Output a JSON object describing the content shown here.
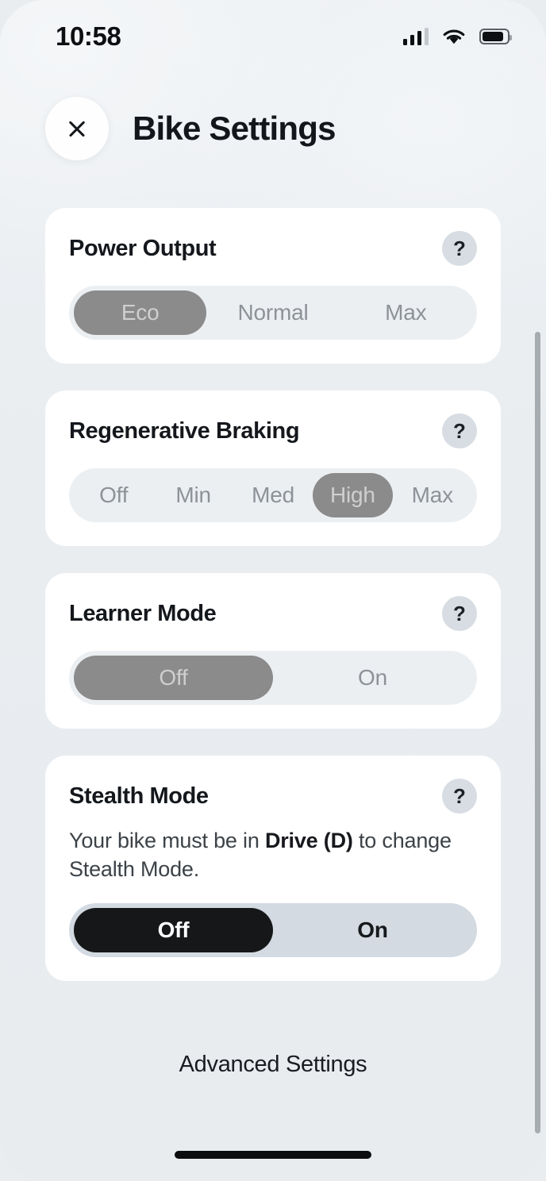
{
  "status_bar": {
    "time": "10:58",
    "cellular_icon": "cellular-signal-icon",
    "wifi_icon": "wifi-icon",
    "battery_icon": "battery-icon"
  },
  "header": {
    "close_icon": "close-icon",
    "title": "Bike Settings"
  },
  "help_label": "?",
  "cards": [
    {
      "id": "power",
      "title": "Power Output",
      "options": [
        "Eco",
        "Normal",
        "Max"
      ],
      "selected": "Eco"
    },
    {
      "id": "regen",
      "title": "Regenerative Braking",
      "options": [
        "Off",
        "Min",
        "Med",
        "High",
        "Max"
      ],
      "selected": "High"
    },
    {
      "id": "learner",
      "title": "Learner Mode",
      "options": [
        "Off",
        "On"
      ],
      "selected": "Off"
    },
    {
      "id": "stealth",
      "title": "Stealth Mode",
      "note_prefix": "Your bike must be in ",
      "note_bold": "Drive (D)",
      "note_suffix": " to change Stealth Mode.",
      "options": [
        "Off",
        "On"
      ],
      "selected": "Off"
    }
  ],
  "power": {
    "title": "Power Output",
    "opt0": "Eco",
    "opt1": "Normal",
    "opt2": "Max"
  },
  "regen": {
    "title": "Regenerative Braking",
    "opt0": "Off",
    "opt1": "Min",
    "opt2": "Med",
    "opt3": "High",
    "opt4": "Max"
  },
  "learner": {
    "title": "Learner Mode",
    "opt0": "Off",
    "opt1": "On"
  },
  "stealth": {
    "title": "Stealth Mode",
    "note_prefix": "Your bike must be in ",
    "note_bold": "Drive (D)",
    "note_suffix": " to change Stealth Mode.",
    "opt0": "Off",
    "opt1": "On"
  },
  "footer": {
    "advanced_settings": "Advanced Settings"
  },
  "colors": {
    "background": "#e9edf0",
    "card": "#ffffff",
    "track": "#eceff2",
    "track_active": "#d3dae1",
    "pill_disabled": "#8b8b8b",
    "pill_active": "#151718",
    "help_circle": "#d7dde2",
    "text_primary": "#14171b",
    "text_muted": "#8d9298"
  }
}
